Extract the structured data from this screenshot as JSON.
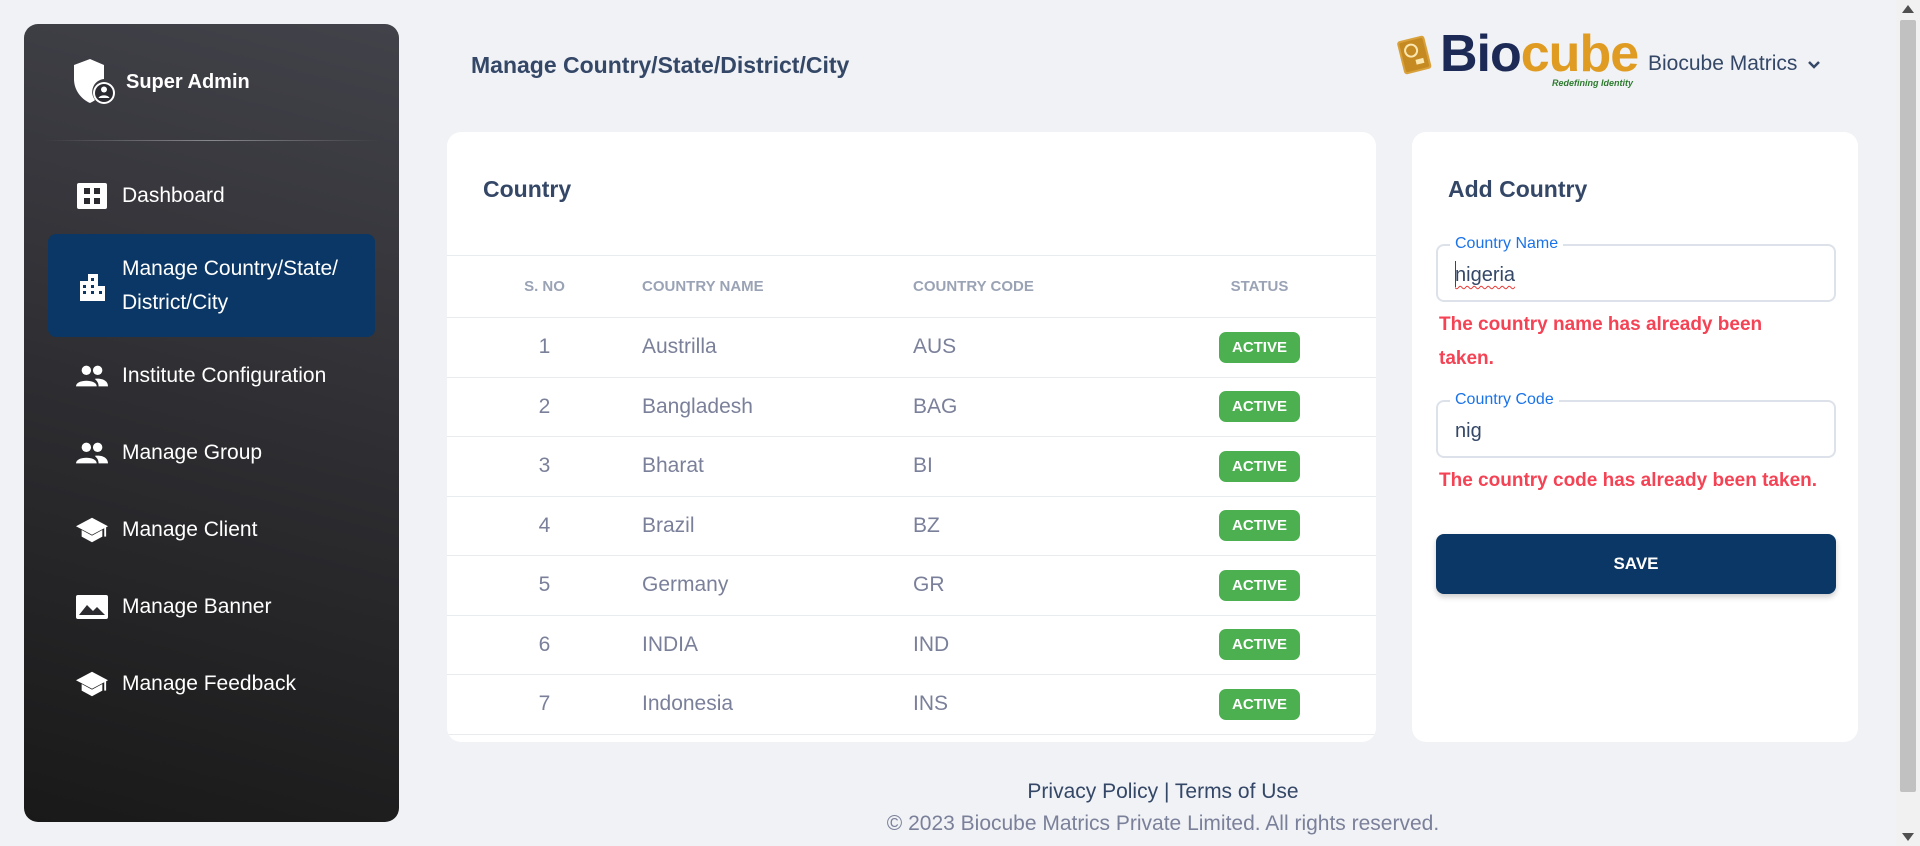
{
  "sidebar": {
    "brand_label": "Super Admin",
    "items": [
      {
        "label": "Dashboard",
        "icon": "dashboard-icon"
      },
      {
        "label": "Manage Country/State/",
        "label2": "District/City",
        "icon": "building-icon"
      },
      {
        "label": "Institute Configuration",
        "icon": "people-icon"
      },
      {
        "label": "Manage Group",
        "icon": "people-icon"
      },
      {
        "label": "Manage Client",
        "icon": "school-icon"
      },
      {
        "label": "Manage Banner",
        "icon": "image-icon"
      },
      {
        "label": "Manage Feedback",
        "icon": "school-icon"
      }
    ]
  },
  "header": {
    "title": "Manage Country/State/District/City",
    "logo_bio": "Bio",
    "logo_cube": "cube",
    "logo_tagline": "Redefining Identity",
    "account_name": "Biocube Matrics"
  },
  "country_table": {
    "title": "Country",
    "columns": [
      "S. NO",
      "COUNTRY NAME",
      "COUNTRY CODE",
      "STATUS"
    ],
    "rows": [
      {
        "sno": "1",
        "name": "Austrilla",
        "code": "AUS",
        "status": "ACTIVE"
      },
      {
        "sno": "2",
        "name": "Bangladesh",
        "code": "BAG",
        "status": "ACTIVE"
      },
      {
        "sno": "3",
        "name": "Bharat",
        "code": "BI",
        "status": "ACTIVE"
      },
      {
        "sno": "4",
        "name": "Brazil",
        "code": "BZ",
        "status": "ACTIVE"
      },
      {
        "sno": "5",
        "name": "Germany",
        "code": "GR",
        "status": "ACTIVE"
      },
      {
        "sno": "6",
        "name": "INDIA",
        "code": "IND",
        "status": "ACTIVE"
      },
      {
        "sno": "7",
        "name": "Indonesia",
        "code": "INS",
        "status": "ACTIVE"
      }
    ]
  },
  "add_country": {
    "title": "Add Country",
    "name_label": "Country Name",
    "name_value": "nigeria",
    "name_error": "The country name has already been",
    "name_error2": "taken.",
    "code_label": "Country Code",
    "code_value": "nig",
    "code_error": "The country code has already been taken.",
    "save_label": "SAVE"
  },
  "footer": {
    "privacy": "Privacy Policy",
    "separator": "|",
    "terms": "Terms of Use",
    "copyright": "© 2023 Biocube Matrics Private Limited. All rights reserved."
  },
  "colors": {
    "primary": "#0a3765",
    "success": "#4caf50",
    "error": "#f44355",
    "label_blue": "#1a73e8"
  }
}
